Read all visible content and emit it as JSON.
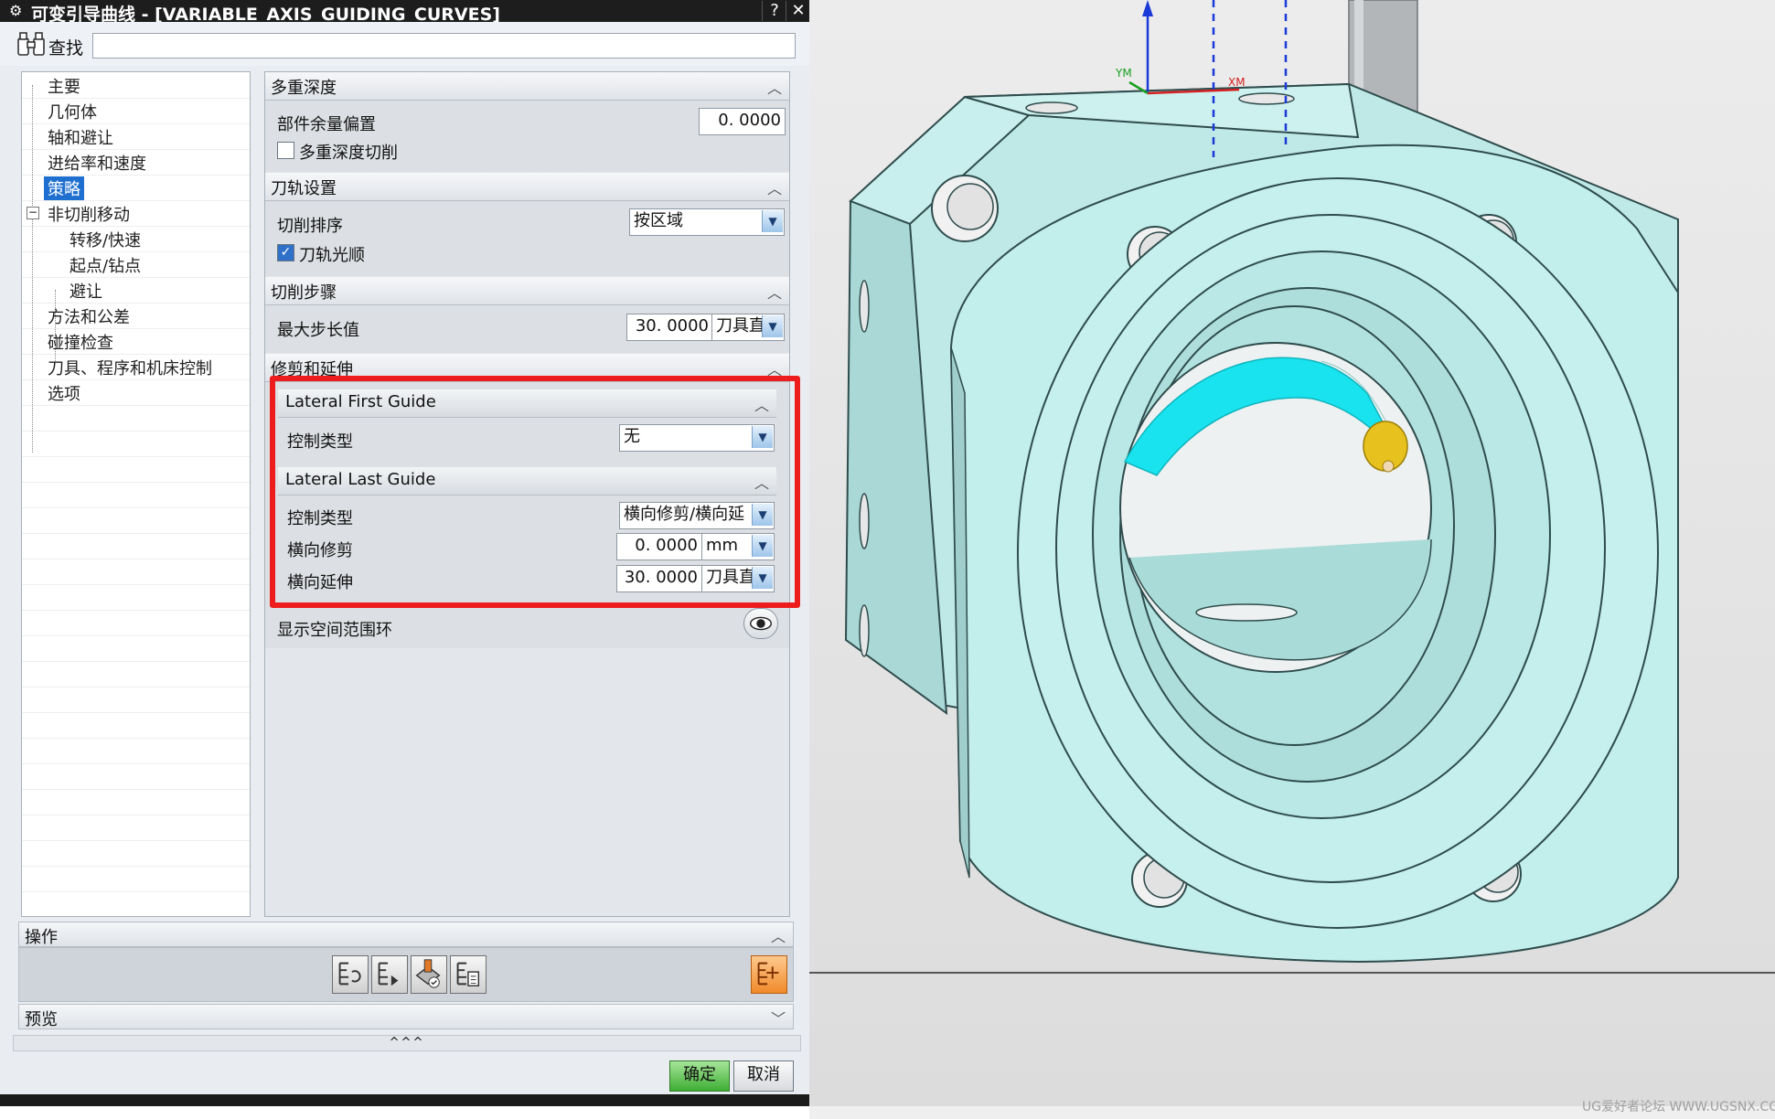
{
  "dialog": {
    "title": "可变引导曲线 - [VARIABLE_AXIS_GUIDING_CURVES]",
    "help_label": "?",
    "close_label": "✕",
    "find_label": "查找",
    "find_value": ""
  },
  "tree": {
    "items": [
      {
        "label": "主要"
      },
      {
        "label": "几何体"
      },
      {
        "label": "轴和避让"
      },
      {
        "label": "进给率和速度"
      },
      {
        "label": "策略"
      },
      {
        "label": "非切削移动"
      },
      {
        "label": "转移/快速"
      },
      {
        "label": "起点/钻点"
      },
      {
        "label": "避让"
      },
      {
        "label": "方法和公差"
      },
      {
        "label": "碰撞检查"
      },
      {
        "label": "刀具、程序和机床控制"
      },
      {
        "label": "选项"
      }
    ],
    "expander_symbol": "−"
  },
  "panel": {
    "multi_depth": {
      "header": "多重深度",
      "part_offset_label": "部件余量偏置",
      "part_offset_value": "0. 0000",
      "multi_depth_cut_label": "多重深度切削",
      "multi_depth_cut_checked": false
    },
    "path_settings": {
      "header": "刀轨设置",
      "cut_order_label": "切削排序",
      "cut_order_value": "按区域",
      "smooth_label": "刀轨光顺",
      "smooth_checked": true
    },
    "cut_step": {
      "header": "切削步骤",
      "max_step_label": "最大步长值",
      "max_step_value": "30. 0000",
      "max_step_unit": "刀具直"
    },
    "trim_extend": {
      "header": "修剪和延伸",
      "first_guide": {
        "header": "Lateral First Guide",
        "control_type_label": "控制类型",
        "control_type_value": "无"
      },
      "last_guide": {
        "header": "Lateral Last Guide",
        "control_type_label": "控制类型",
        "control_type_value": "横向修剪/横向延",
        "trim_label": "横向修剪",
        "trim_value": "0. 0000",
        "trim_unit": "mm",
        "extend_label": "横向延伸",
        "extend_value": "30. 0000",
        "extend_unit": "刀具直"
      }
    },
    "display_range_label": "显示空间范围环"
  },
  "operations": {
    "header": "操作",
    "buttons": [
      "generate-icon",
      "replay-icon",
      "verify-icon",
      "list-icon",
      "output-icon"
    ]
  },
  "preview": {
    "header": "预览"
  },
  "more_label": "^^^",
  "footer": {
    "ok_label": "确定",
    "cancel_label": "取消"
  },
  "viewport": {
    "axis_labels": {
      "y": "YM",
      "x": "XM"
    },
    "watermark": "UG爱好者论坛 WWW.UGSNX.COM"
  },
  "colors": {
    "part": "#c2eeec",
    "toolpath": "#19e3ee",
    "highlight_box": "#ee1d1d",
    "selection": "#1e6fcf"
  }
}
